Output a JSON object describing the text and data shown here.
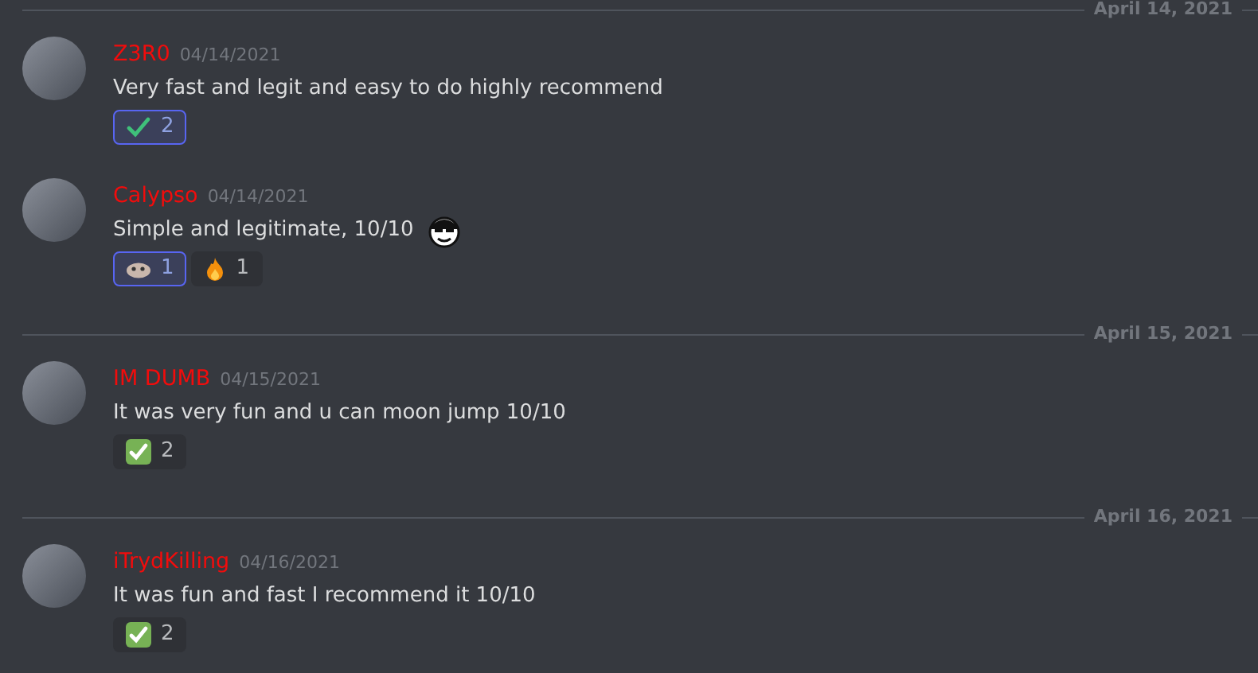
{
  "feed": [
    {
      "kind": "divider",
      "label": "April 14, 2021"
    },
    {
      "kind": "message",
      "author": "Z3R0",
      "time": "04/14/2021",
      "text": "Very fast and legit and easy to do highly recommend",
      "reactions": [
        {
          "kind": "check-mark",
          "count": "2",
          "selected": true
        }
      ]
    },
    {
      "kind": "message",
      "author": "Calypso",
      "time": "04/14/2021",
      "text": "Simple and legitimate, 10/10",
      "inline_emoji": true,
      "reactions": [
        {
          "kind": "custom",
          "count": "1",
          "selected": true
        },
        {
          "kind": "fire",
          "count": "1",
          "selected": false
        }
      ]
    },
    {
      "kind": "divider",
      "label": "April 15, 2021"
    },
    {
      "kind": "message",
      "author": "IM DUMB",
      "time": "04/15/2021",
      "text": "It was very fun and u can moon jump 10/10",
      "reactions": [
        {
          "kind": "check-box",
          "count": "2",
          "selected": false
        }
      ]
    },
    {
      "kind": "divider",
      "label": "April 16, 2021"
    },
    {
      "kind": "message",
      "author": "iTrydKilling",
      "time": "04/16/2021",
      "text": "It was fun and fast I recommend it 10/10",
      "reactions": [
        {
          "kind": "check-box",
          "count": "2",
          "selected": false
        }
      ]
    }
  ]
}
